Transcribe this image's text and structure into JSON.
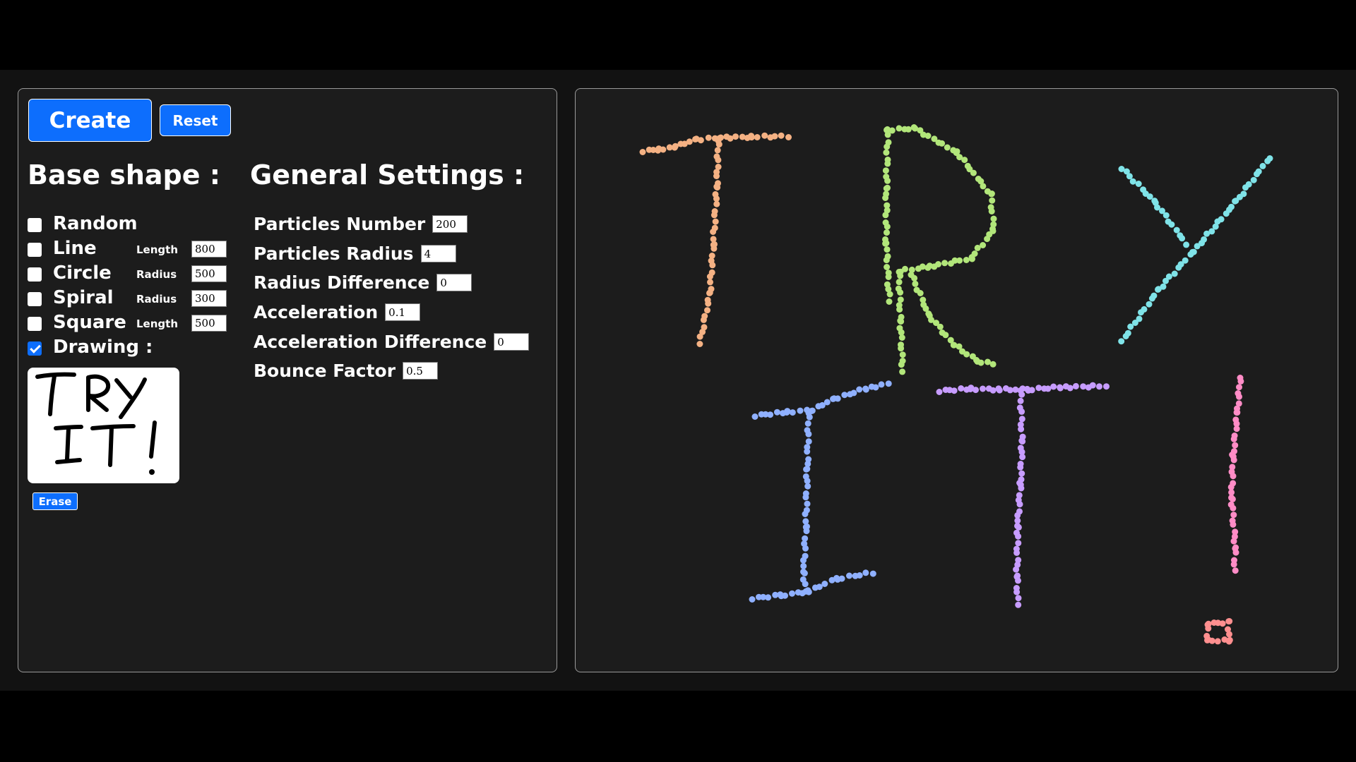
{
  "toolbar": {
    "create_label": "Create",
    "reset_label": "Reset"
  },
  "base_shape": {
    "heading": "Base shape :",
    "options": [
      {
        "id": "random",
        "label": "Random",
        "checked": false
      },
      {
        "id": "line",
        "label": "Line",
        "checked": false,
        "param_label": "Length",
        "param_value": "800"
      },
      {
        "id": "circle",
        "label": "Circle",
        "checked": false,
        "param_label": "Radius",
        "param_value": "500"
      },
      {
        "id": "spiral",
        "label": "Spiral",
        "checked": false,
        "param_label": "Radius",
        "param_value": "300"
      },
      {
        "id": "square",
        "label": "Square",
        "checked": false,
        "param_label": "Length",
        "param_value": "500"
      },
      {
        "id": "drawing",
        "label": "Drawing :",
        "checked": true
      }
    ],
    "erase_label": "Erase"
  },
  "general_settings": {
    "heading": "General Settings :",
    "fields": [
      {
        "label": "Particles Number",
        "value": "200"
      },
      {
        "label": "Particles Radius",
        "value": "4"
      },
      {
        "label": "Radius Difference",
        "value": "0"
      },
      {
        "label": "Acceleration",
        "value": "0.1"
      },
      {
        "label": "Acceleration Difference",
        "value": "0"
      },
      {
        "label": "Bounce Factor",
        "value": "0.5"
      }
    ]
  },
  "colors": {
    "accent": "#0d6efd",
    "panel_bg": "#1c1c1c",
    "app_bg": "#121212",
    "panel_border": "#9a9a9a",
    "stroke_palette": [
      "#f4b183",
      "#b2e67a",
      "#7fe3e8",
      "#8fb0ff",
      "#c79cff",
      "#ff8cc6",
      "#ff8f8f"
    ]
  }
}
